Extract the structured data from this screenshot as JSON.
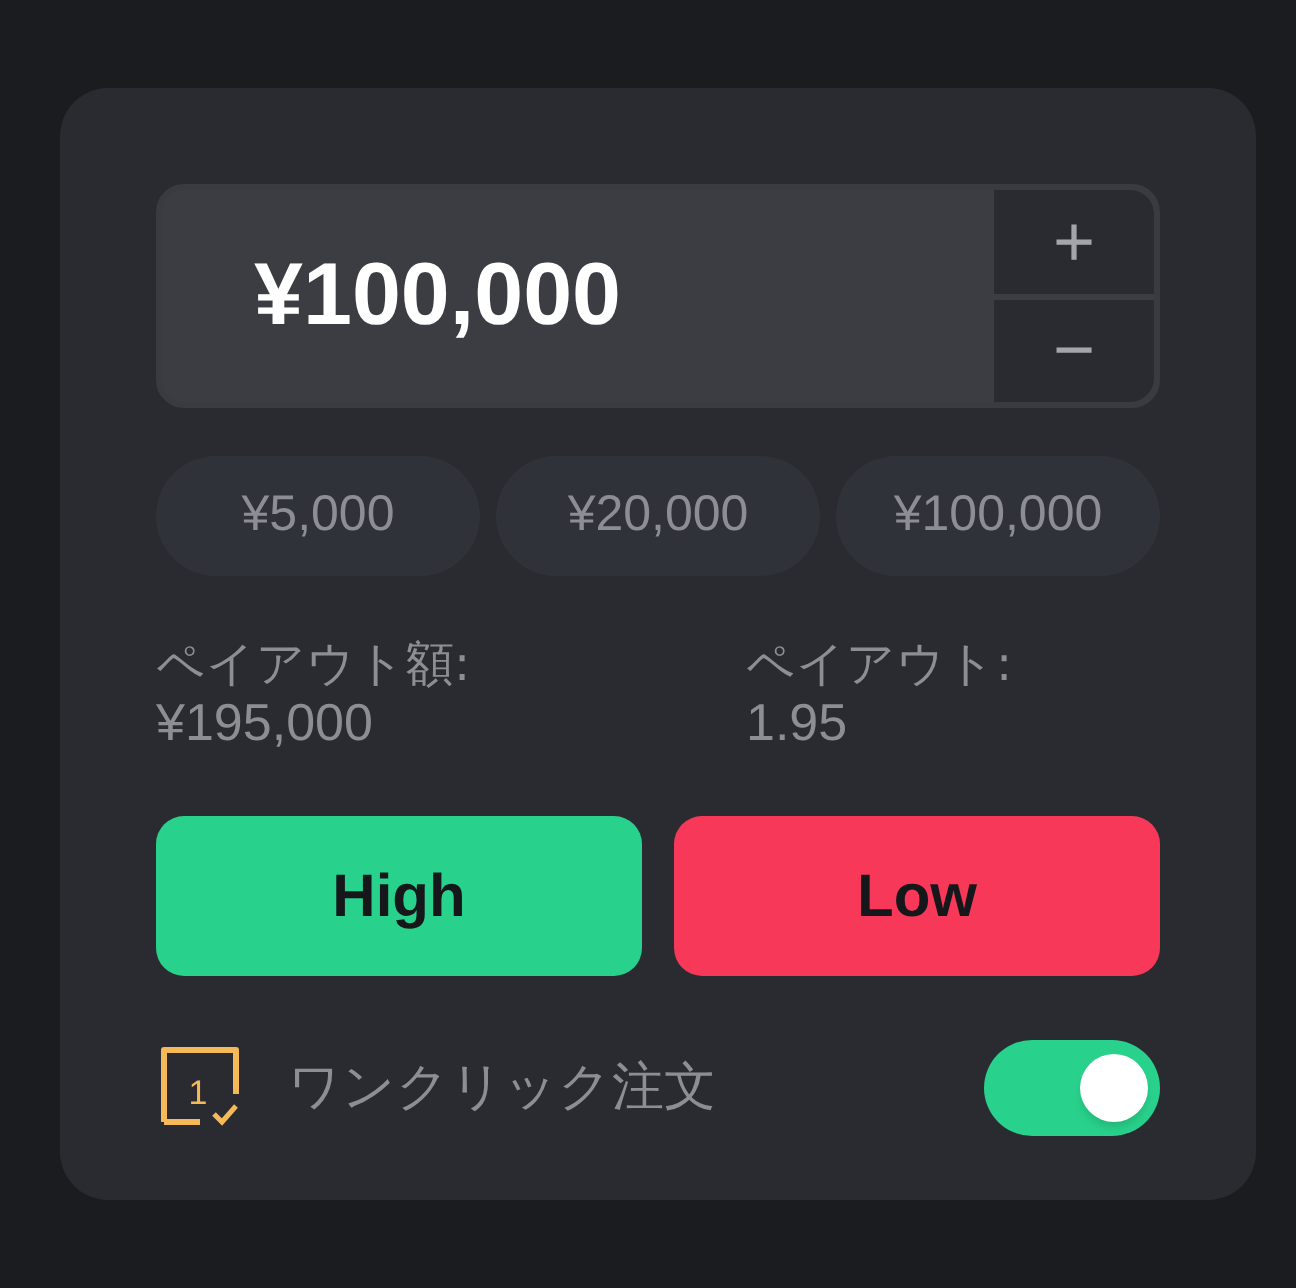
{
  "amount": {
    "value": "¥100,000",
    "increment": "+",
    "decrement": "−"
  },
  "presets": [
    {
      "label": "¥5,000"
    },
    {
      "label": "¥20,000"
    },
    {
      "label": "¥100,000"
    }
  ],
  "payout": [
    {
      "label": "ペイアウト額:",
      "value": "¥195,000"
    },
    {
      "label": "ペイアウト:",
      "value": "1.95"
    }
  ],
  "trade_buttons": [
    {
      "label": "High",
      "kind": "high"
    },
    {
      "label": "Low",
      "kind": "low"
    }
  ],
  "one_click": {
    "icon_digit": "1",
    "label": "ワンクリック注文",
    "on": true
  }
}
